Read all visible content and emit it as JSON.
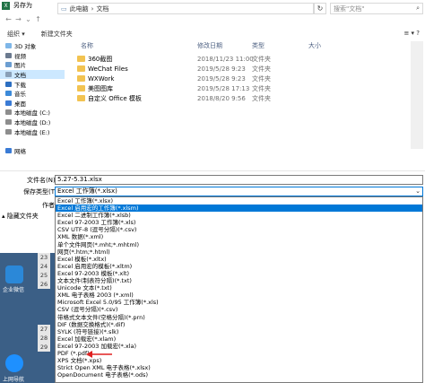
{
  "window": {
    "title": "另存为",
    "app_icon": "X"
  },
  "address": {
    "segments": [
      "此电脑",
      "›",
      "文档"
    ],
    "search_placeholder": "搜索\"文档\""
  },
  "toolbar": {
    "organize": "组织 ▾",
    "new_folder": "新建文件夹",
    "view": "≡ ▾  ?"
  },
  "sidebar": {
    "items": [
      {
        "label": "3D 对象",
        "color": "#7eb6e8"
      },
      {
        "label": "视频",
        "color": "#6b7a8f"
      },
      {
        "label": "图片",
        "color": "#6c9ed1"
      },
      {
        "label": "文档",
        "color": "#8aa0b8",
        "selected": true
      },
      {
        "label": "下载",
        "color": "#2d6fc1"
      },
      {
        "label": "音乐",
        "color": "#3c8ad9"
      },
      {
        "label": "桌面",
        "color": "#3a7bd5"
      },
      {
        "label": "本地磁盘 (C:)",
        "color": "#8d8d8d"
      },
      {
        "label": "本地磁盘 (D:)",
        "color": "#8d8d8d"
      },
      {
        "label": "本地磁盘 (E:)",
        "color": "#8d8d8d"
      },
      {
        "label": "",
        "color": ""
      },
      {
        "label": "网络",
        "color": "#3a7bd5"
      }
    ]
  },
  "files": {
    "headers": {
      "name": "名称",
      "date": "修改日期",
      "type": "类型",
      "size": "大小"
    },
    "rows": [
      {
        "name": "360截图",
        "date": "2018/11/23 11:00",
        "type": "文件夹"
      },
      {
        "name": "WeChat Files",
        "date": "2019/5/28 9:23",
        "type": "文件夹"
      },
      {
        "name": "WXWork",
        "date": "2019/5/28 9:23",
        "type": "文件夹"
      },
      {
        "name": "美图图库",
        "date": "2019/5/28 17:13",
        "type": "文件夹"
      },
      {
        "name": "自定义 Office 模板",
        "date": "2018/8/20 9:56",
        "type": "文件夹"
      }
    ]
  },
  "form": {
    "filename_label": "文件名(N):",
    "filename_value": "5.27-5.31.xlsx",
    "filetype_label": "保存类型(T):",
    "filetype_value": "Excel 工作簿(*.xlsx)",
    "author_label": "作者:"
  },
  "hide_folders": "▴ 隐藏文件夹",
  "file_types": [
    "Excel 工作簿(*.xlsx)",
    "Excel 启用宏的工作簿(*.xlsm)",
    "Excel 二进制工作簿(*.xlsb)",
    "Excel 97-2003 工作簿(*.xls)",
    "CSV UTF-8 (逗号分隔)(*.csv)",
    "XML 数据(*.xml)",
    "单个文件网页(*.mht;*.mhtml)",
    "网页(*.htm;*.html)",
    "Excel 模板(*.xltx)",
    "Excel 启用宏的模板(*.xltm)",
    "Excel 97-2003 模板(*.xlt)",
    "文本文件(制表符分隔)(*.txt)",
    "Unicode 文本(*.txt)",
    "XML 电子表格 2003 (*.xml)",
    "Microsoft Excel 5.0/95 工作簿(*.xls)",
    "CSV (逗号分隔)(*.csv)",
    "带格式文本文件(空格分隔)(*.prn)",
    "DIF (数据交换格式)(*.dif)",
    "SYLK (符号链接)(*.slk)",
    "Excel 加载宏(*.xlam)",
    "Excel 97-2003 加载宏(*.xla)",
    "PDF (*.pdf)",
    "XPS 文档(*.xps)",
    "Strict Open XML 电子表格(*.xlsx)",
    "OpenDocument 电子表格(*.ods)"
  ],
  "selected_file_type_index": 1,
  "background": {
    "row_numbers": [
      "23",
      "24",
      "25",
      "26",
      "27",
      "28",
      "29"
    ],
    "desktop_labels": [
      "企业微信",
      "上网导航"
    ]
  }
}
